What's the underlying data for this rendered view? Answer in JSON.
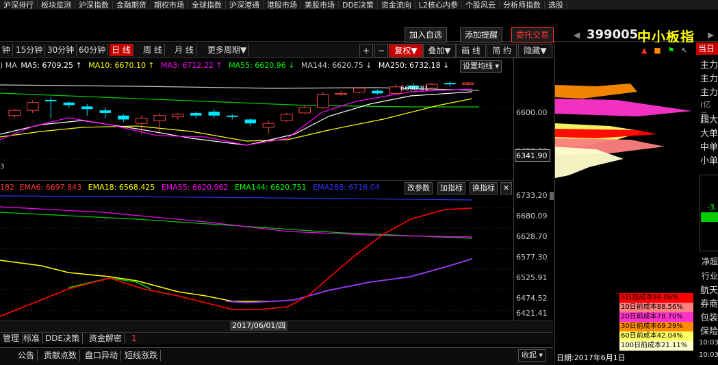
{
  "nav": [
    "沪深排行",
    "板块监测",
    "沪深指数",
    "金融期货",
    "期权市场",
    "全球指数",
    "沪深港通",
    "港股市场",
    "美股市场",
    "DDE决策",
    "资金流向",
    "L2核心内参",
    "个股风云",
    "分析师指数",
    "选股"
  ],
  "header": {
    "add_watch": "加入自选",
    "add_alert": "添加提醒",
    "entrust": "委托交易",
    "code": "399005",
    "name": "中小板指",
    "prev": "◀",
    "more": "▶"
  },
  "periods": [
    "钟",
    "15分钟",
    "30分钟",
    "60分钟",
    "日 线",
    "周 线",
    "月 线",
    "更多周期▼"
  ],
  "active_period": "日 线",
  "tools": {
    "plus": "+",
    "minus": "−",
    "fq": "复权▼",
    "overlay": "叠加▼",
    "draw": "画 线",
    "simple": "简 约",
    "hide": "隐藏▼"
  },
  "ma": {
    "prefix": ") MA",
    "ma5": "MA5: 6709.25 ↑",
    "ma10": "MA10: 6670.10 ↑",
    "ma3": "MA3: 6712.22 ↑",
    "ma55": "MA55: 6620.96 ↓",
    "ma144": "MA144: 6620.75 ↓",
    "ma250": "MA250: 6732.18 ↓",
    "setting": "设置均线 ▾"
  },
  "ema": {
    "ema_first": "182",
    "ema6": "EMA6: 6697.843",
    "ema18": "EMA18: 6568.425",
    "ema55": "EMA55: 6620.962",
    "ema144": "EMA144: 6620.751",
    "ema288": "EMA288: 6716.04",
    "change_param": "改参数",
    "add_ind": "加指标",
    "switch_ind": "换指标",
    "close": "✕"
  },
  "price_axis_top": [
    "6600.00",
    "6400.00",
    "6341.90"
  ],
  "price_axis_bottom": [
    "6733.20",
    "6680.09",
    "6628.70",
    "6577.30",
    "6525.91",
    "6474.52",
    "6421.41"
  ],
  "kline_label": "3",
  "high_label": "6690.81",
  "date_label": "2017/06/01/四",
  "bottom_tabs1": [
    "管理",
    "标准",
    "DDE决策",
    "资金解密",
    "1"
  ],
  "bottom_tabs2": [
    "公告",
    "贡献点数",
    "盘口异动",
    "短线涨跌"
  ],
  "bottom_right": "收起 ▾",
  "date_bottom": "日期:2017年6月1日",
  "right_panel": {
    "today": "当日",
    "fund_rows": [
      "主力",
      "主力",
      "主力",
      "(亿元",
      "超大",
      "大单",
      "中单",
      "小单"
    ],
    "value": "-3.",
    "net": "净超",
    "industry": "行业",
    "industries": [
      "航天",
      "券商",
      "包装",
      "保险"
    ],
    "time1": "10:03",
    "time2": "10:03"
  },
  "cost_legend": [
    {
      "label": "5日前成本94.06%",
      "color": "#ff0000"
    },
    {
      "label": "10日前成本88.56%",
      "color": "#ff8080"
    },
    {
      "label": "20日前成本78.70%",
      "color": "#ff33cc"
    },
    {
      "label": "30日前成本69.29%",
      "color": "#ff8c00"
    },
    {
      "label": "60日前成本42.04%",
      "color": "#ffff66"
    },
    {
      "label": "100日前成本21.11%",
      "color": "#ffffcc"
    }
  ],
  "colors": {
    "up": "#ff4444",
    "down": "#00e5ff",
    "accent": "#c60000",
    "name": "#ffff00"
  },
  "chart_data": {
    "type": "line",
    "candles": [
      {
        "o": 6570,
        "c": 6590,
        "h": 6595,
        "l": 6560,
        "up": true
      },
      {
        "o": 6590,
        "c": 6620,
        "h": 6628,
        "l": 6580,
        "up": true
      },
      {
        "o": 6630,
        "c": 6625,
        "h": 6640,
        "l": 6560,
        "up": false
      },
      {
        "o": 6620,
        "c": 6610,
        "h": 6625,
        "l": 6600,
        "up": false
      },
      {
        "o": 6605,
        "c": 6595,
        "h": 6615,
        "l": 6570,
        "up": false
      },
      {
        "o": 6590,
        "c": 6580,
        "h": 6600,
        "l": 6560,
        "up": false
      },
      {
        "o": 6570,
        "c": 6555,
        "h": 6575,
        "l": 6545,
        "up": false
      },
      {
        "o": 6560,
        "c": 6540,
        "h": 6570,
        "l": 6500,
        "up": true
      },
      {
        "o": 6550,
        "c": 6570,
        "h": 6580,
        "l": 6510,
        "up": true
      },
      {
        "o": 6565,
        "c": 6575,
        "h": 6580,
        "l": 6555,
        "up": true
      },
      {
        "o": 6580,
        "c": 6570,
        "h": 6585,
        "l": 6560,
        "up": false
      },
      {
        "o": 6585,
        "c": 6570,
        "h": 6595,
        "l": 6560,
        "up": false
      },
      {
        "o": 6570,
        "c": 6565,
        "h": 6575,
        "l": 6555,
        "up": false
      },
      {
        "o": 6555,
        "c": 6540,
        "h": 6560,
        "l": 6530,
        "up": false
      },
      {
        "o": 6525,
        "c": 6540,
        "h": 6550,
        "l": 6500,
        "up": true
      },
      {
        "o": 6550,
        "c": 6575,
        "h": 6580,
        "l": 6545,
        "up": true
      },
      {
        "o": 6580,
        "c": 6600,
        "h": 6610,
        "l": 6575,
        "up": true
      },
      {
        "o": 6600,
        "c": 6650,
        "h": 6660,
        "l": 6595,
        "up": true
      },
      {
        "o": 6650,
        "c": 6655,
        "h": 6665,
        "l": 6645,
        "up": true
      },
      {
        "o": 6660,
        "c": 6675,
        "h": 6680,
        "l": 6655,
        "up": true
      },
      {
        "o": 6665,
        "c": 6655,
        "h": 6670,
        "l": 6650,
        "up": false
      },
      {
        "o": 6655,
        "c": 6680,
        "h": 6690,
        "l": 6650,
        "up": true
      },
      {
        "o": 6685,
        "c": 6675,
        "h": 6695,
        "l": 6670,
        "up": false
      },
      {
        "o": 6675,
        "c": 6690,
        "h": 6695,
        "l": 6670,
        "up": true
      },
      {
        "o": 6695,
        "c": 6690,
        "h": 6700,
        "l": 6680,
        "up": false
      },
      {
        "o": 6690,
        "c": 6695,
        "h": 6700,
        "l": 6685,
        "up": true
      }
    ],
    "ylim_top": [
      6320,
      6740
    ],
    "ylim_bottom": [
      6421.41,
      6733.2
    ]
  }
}
